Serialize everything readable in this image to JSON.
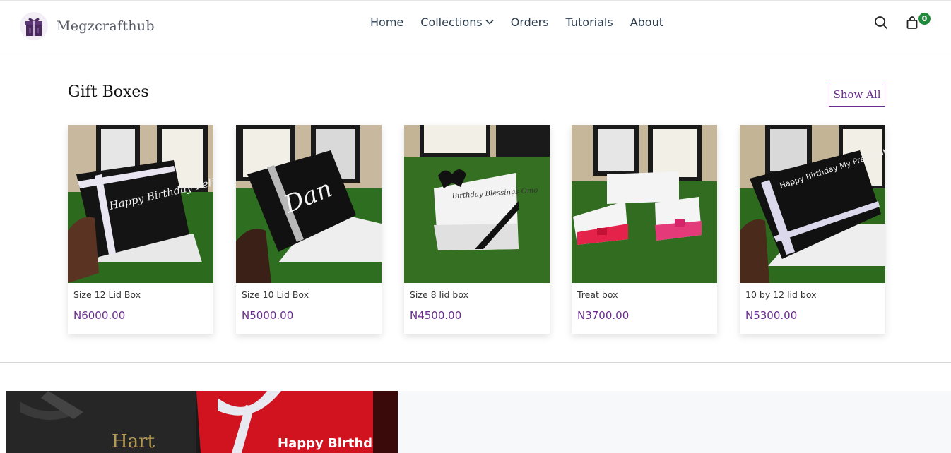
{
  "brand": {
    "name": "Megzcrafthub",
    "accent": "#6a2d8e"
  },
  "nav": {
    "items": [
      {
        "label": "Home"
      },
      {
        "label": "Collections",
        "has_dropdown": true
      },
      {
        "label": "Orders"
      },
      {
        "label": "Tutorials"
      },
      {
        "label": "About"
      }
    ]
  },
  "header_actions": {
    "search_icon": "search-icon",
    "cart_icon": "bag-icon",
    "cart_count": "0",
    "badge_color": "#1e8a3a"
  },
  "section": {
    "title": "Gift Boxes",
    "show_all_label": "Show All"
  },
  "products": [
    {
      "name": "Size 12 Lid Box",
      "price": "N6000.00",
      "box_text": "Happy Birthday Felicity"
    },
    {
      "name": "Size 10 Lid Box",
      "price": "N5000.00",
      "box_text": "Dan"
    },
    {
      "name": "Size 8 lid box",
      "price": "N4500.00",
      "box_text": "Birthday Blessings Omo"
    },
    {
      "name": "Treat box",
      "price": "N3700.00"
    },
    {
      "name": "10 by 12 lid box",
      "price": "N5300.00",
      "box_text": "Happy Birthday My Pretty Little Princess Catherine"
    }
  ],
  "banner": {
    "texts": [
      "Hart",
      "Happy Birthday"
    ]
  }
}
